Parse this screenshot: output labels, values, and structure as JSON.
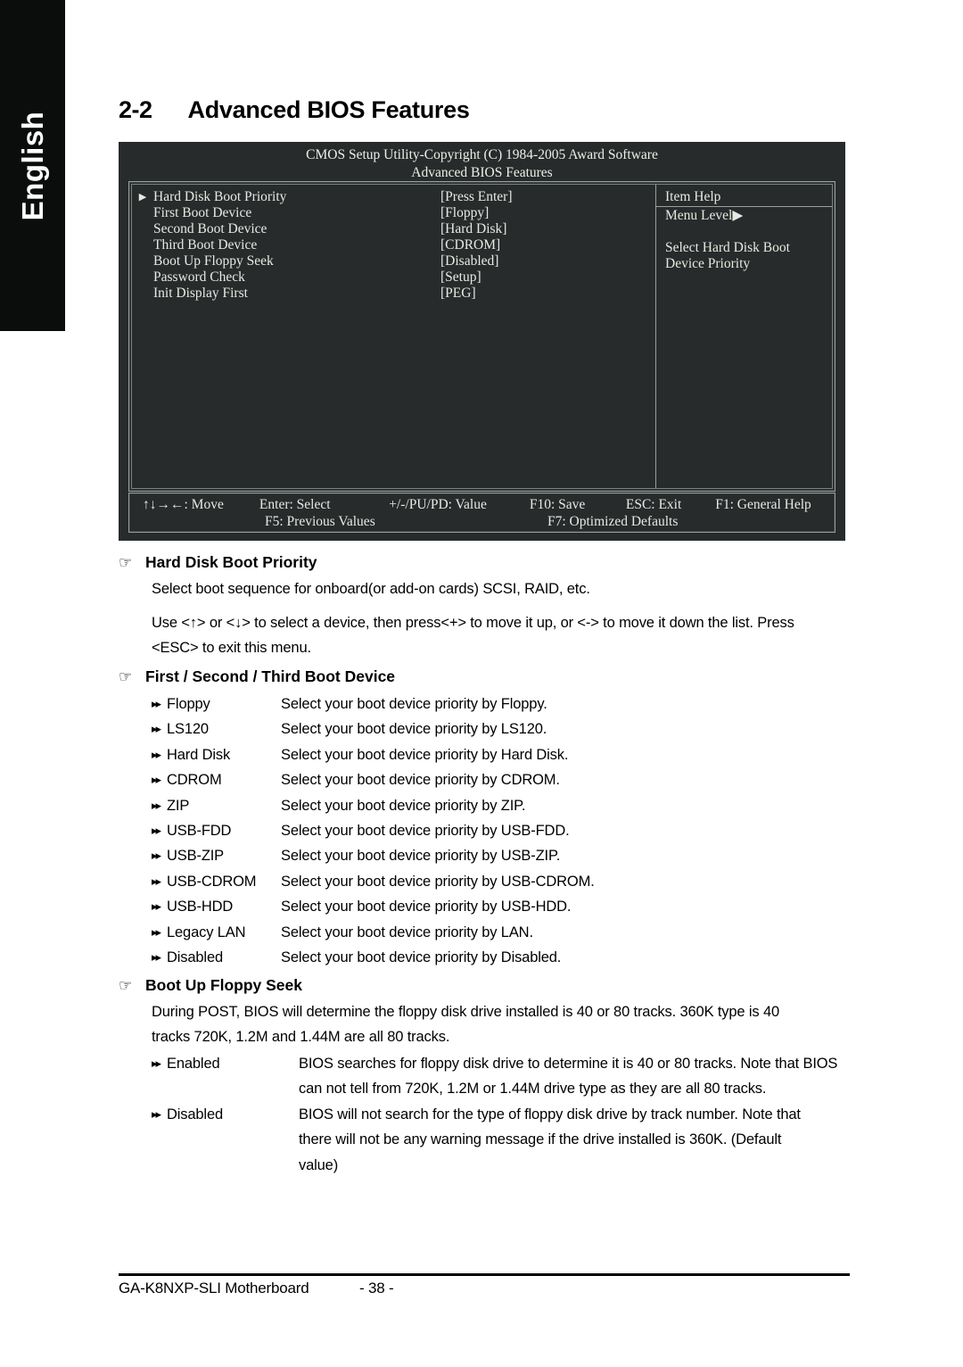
{
  "language_tab": {
    "label": "English"
  },
  "section": {
    "number": "2-2",
    "title": "Advanced BIOS Features"
  },
  "bios_screen": {
    "title": "CMOS Setup Utility-Copyright (C) 1984-2005 Award Software",
    "subtitle": "Advanced BIOS Features",
    "rows": [
      {
        "arrow": "▶",
        "label": "Hard Disk Boot Priority",
        "value": "[Press Enter]"
      },
      {
        "arrow": "",
        "label": "First Boot Device",
        "value": "[Floppy]"
      },
      {
        "arrow": "",
        "label": "Second Boot Device",
        "value": "[Hard Disk]"
      },
      {
        "arrow": "",
        "label": "Third Boot Device",
        "value": "[CDROM]"
      },
      {
        "arrow": "",
        "label": "Boot Up Floppy Seek",
        "value": "[Disabled]"
      },
      {
        "arrow": "",
        "label": "Password Check",
        "value": "[Setup]"
      },
      {
        "arrow": "",
        "label": "Init Display First",
        "value": "[PEG]"
      }
    ],
    "item_help": {
      "title": "Item Help",
      "menu_level": "Menu Level▶",
      "description_line1": "Select Hard Disk Boot",
      "description_line2": "Device Priority"
    },
    "footer": {
      "move": "↑↓→←: Move",
      "enter": "Enter: Select",
      "value": "+/-/PU/PD: Value",
      "f10": "F10: Save",
      "esc": "ESC: Exit",
      "f1": "F1: General Help",
      "f5": "F5: Previous Values",
      "f7": "F7: Optimized Defaults"
    }
  },
  "sections": {
    "hard_disk_boot_priority": {
      "heading": "Hard Disk Boot Priority",
      "para1": "Select boot sequence for onboard(or add-on cards) SCSI, RAID, etc.",
      "para2_line1": "Use <↑> or <↓> to select a device, then press<+> to move it up, or <-> to move it down the list. Press",
      "para2_line2": "<ESC> to exit this menu."
    },
    "boot_device": {
      "heading": "First / Second / Third Boot Device",
      "items": [
        {
          "term": "Floppy",
          "desc": "Select your boot device priority by Floppy."
        },
        {
          "term": "LS120",
          "desc": "Select your boot device priority by LS120."
        },
        {
          "term": "Hard Disk",
          "desc": "Select your boot device priority by Hard Disk."
        },
        {
          "term": "CDROM",
          "desc": "Select your boot device priority by CDROM."
        },
        {
          "term": "ZIP",
          "desc": "Select your boot device priority by ZIP."
        },
        {
          "term": "USB-FDD",
          "desc": "Select your boot device priority by USB-FDD."
        },
        {
          "term": "USB-ZIP",
          "desc": "Select your boot device priority by USB-ZIP."
        },
        {
          "term": "USB-CDROM",
          "desc": "Select your boot device priority by USB-CDROM."
        },
        {
          "term": "USB-HDD",
          "desc": "Select your boot device priority by USB-HDD."
        },
        {
          "term": "Legacy LAN",
          "desc": "Select your boot device priority by LAN."
        },
        {
          "term": "Disabled",
          "desc": "Select your boot device priority by Disabled."
        }
      ]
    },
    "boot_up_floppy_seek": {
      "heading": "Boot Up Floppy Seek",
      "para_line1": "During POST, BIOS will determine the floppy disk drive installed is 40 or 80 tracks. 360K type is 40",
      "para_line2": "tracks 720K, 1.2M and 1.44M are all 80 tracks.",
      "items": [
        {
          "term": "Enabled",
          "lines": [
            "BIOS searches for floppy disk drive to determine it is 40 or 80 tracks. Note that BIOS",
            "can not tell from 720K, 1.2M or 1.44M drive type as they are all 80 tracks."
          ]
        },
        {
          "term": "Disabled",
          "lines": [
            "BIOS will not search for the type of floppy disk drive by track number. Note that",
            "there will not be any warning message if the drive installed is 360K. (Default",
            "value)"
          ]
        }
      ]
    }
  },
  "page_footer": {
    "product": "GA-K8NXP-SLI Motherboard",
    "page_number": "- 38 -"
  },
  "icons": {
    "hand_pointer": "☞",
    "double_triangle": "▸▸",
    "menu_arrow": "▶"
  },
  "colors": {
    "bios_background": "#272b2b",
    "bios_text": "#e9e9e3",
    "tab_background": "#0b0d0d",
    "page_background": "#ffffff"
  }
}
